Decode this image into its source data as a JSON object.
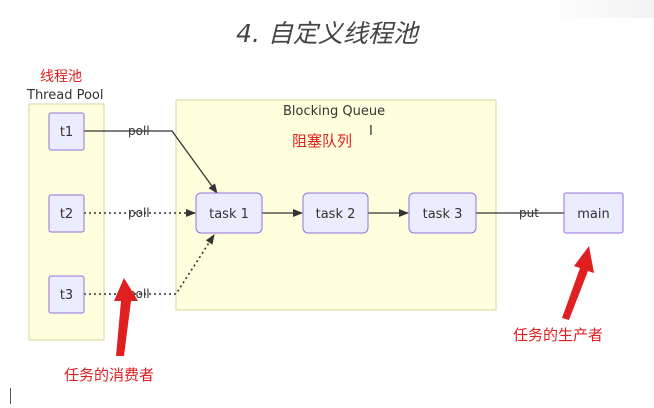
{
  "title": "4. 自定义线程池",
  "thread_pool": {
    "label_cn": "线程池",
    "label_en": "Thread Pool",
    "threads": [
      "t1",
      "t2",
      "t3"
    ]
  },
  "blocking_queue": {
    "label_en": "Blocking Queue",
    "label_cn": "阻塞队列",
    "tasks": [
      "task 1",
      "task 2",
      "task 3"
    ]
  },
  "producer": {
    "label": "main"
  },
  "edges": {
    "poll_label": "poll",
    "put_label": "put"
  },
  "annotations": {
    "consumer": "任务的消费者",
    "producer": "任务的生产者",
    "cursor": "I"
  },
  "colors": {
    "node_fill": "#ECECFF",
    "node_stroke": "#9370DB",
    "pool_fill": "#FFFFDE",
    "pool_stroke": "#D6D69A",
    "annotation_red": "#E02020"
  }
}
